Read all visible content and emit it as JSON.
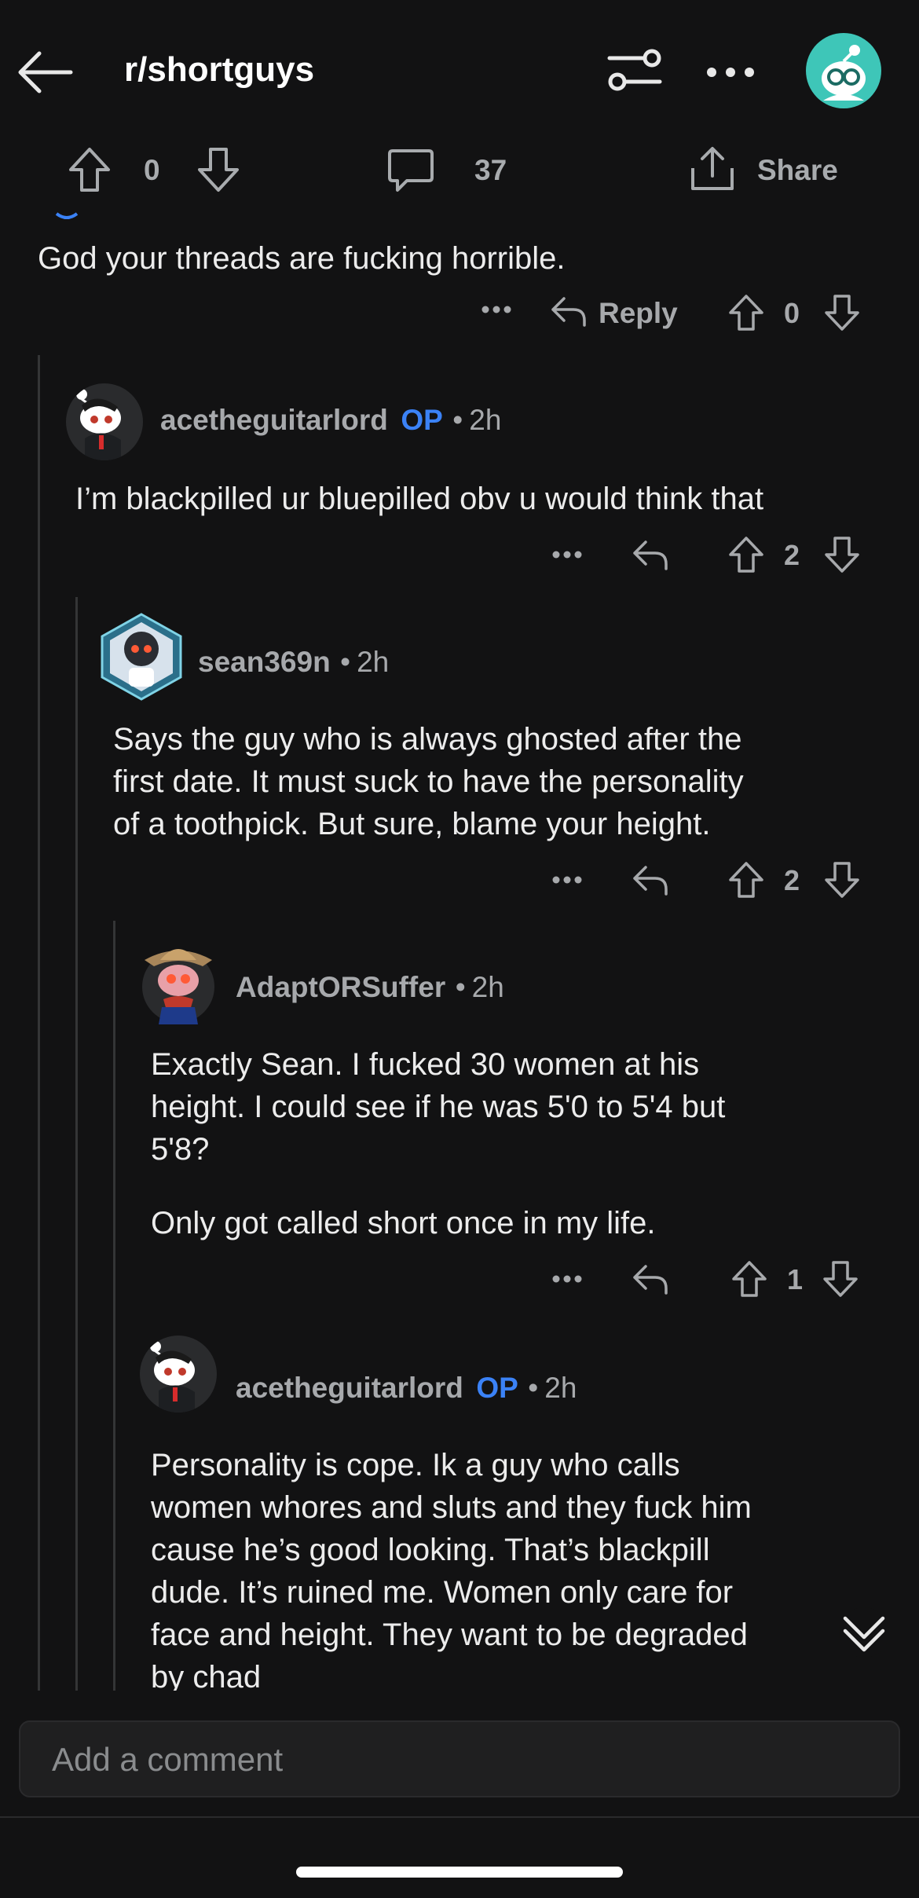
{
  "header": {
    "subreddit": "r/shortguys"
  },
  "post_actions": {
    "vote_count": "0",
    "comment_count": "37",
    "share_label": "Share"
  },
  "comments": [
    {
      "body": "God your threads are fucking horrible.",
      "reply_label": "Reply",
      "votes": "0"
    },
    {
      "username": "acetheguitarlord",
      "op": "OP",
      "time": "2h",
      "body": "I’m blackpilled ur bluepilled obv u would think that",
      "votes": "2"
    },
    {
      "username": "sean369n",
      "time": "2h",
      "body_lines": [
        "Says the guy who is always ghosted after the",
        "first date. It must suck to have the personality",
        "of a toothpick. But sure, blame your height."
      ],
      "votes": "2"
    },
    {
      "username": "AdaptORSuffer",
      "time": "2h",
      "body_lines": [
        "Exactly Sean. I fucked 30 women at his",
        "height. I could see if he was 5'0 to 5'4 but",
        "5'8?"
      ],
      "body_para2": "Only got called short once in my life.",
      "votes": "1"
    },
    {
      "username": "acetheguitarlord",
      "op": "OP",
      "time": "2h",
      "body_lines": [
        "Personality is cope. Ik a guy who calls",
        "women whores and sluts and they fuck him",
        "cause he’s good looking. That’s blackpill",
        "dude. It’s ruined me. Women only care for",
        "face and height. They want to be degraded",
        "by chad"
      ]
    }
  ],
  "composer": {
    "placeholder": "Add a comment"
  },
  "colors": {
    "background": "#121213",
    "text": "#ececec",
    "muted": "#a7a9ac",
    "op_blue": "#3b82f6",
    "avatar_teal": "#3ec6b8"
  }
}
